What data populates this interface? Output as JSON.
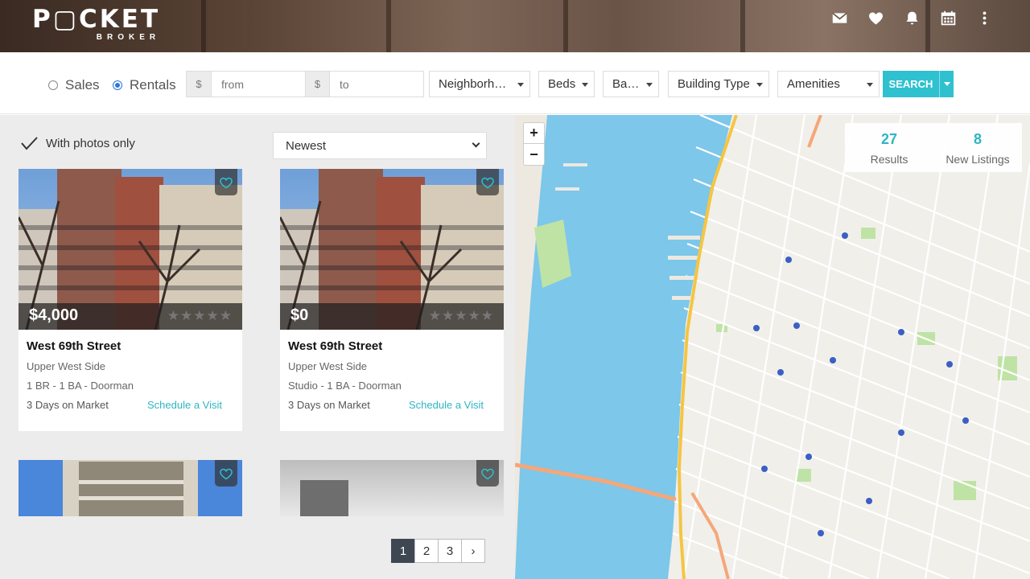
{
  "brand": {
    "name": "P▢CKET",
    "sub": "BROKER"
  },
  "header_icons": [
    "mail-icon",
    "heart-icon",
    "bell-icon",
    "calendar-icon",
    "more-vertical-icon"
  ],
  "filters": {
    "sales_label": "Sales",
    "rentals_label": "Rentals",
    "selected_mode": "Rentals",
    "currency": "$",
    "from_placeholder": "from",
    "to_placeholder": "to",
    "neighborhood": "Neighborhoo…",
    "beds": "Beds",
    "baths": "Baths",
    "building_type": "Building Type",
    "amenities": "Amenities",
    "search_label": "SEARCH"
  },
  "listing_controls": {
    "photos_only_label": "With photos only",
    "sort_value": "Newest"
  },
  "listings": [
    {
      "price": "$4,000",
      "title": "West 69th Street",
      "neighborhood": "Upper West Side",
      "details": "1 BR - 1 BA - Doorman",
      "days": "3 Days on Market",
      "action": "Schedule a Visit"
    },
    {
      "price": "$0",
      "title": "West 69th Street",
      "neighborhood": "Upper West Side",
      "details": "Studio - 1 BA - Doorman",
      "days": "3 Days on Market",
      "action": "Schedule a Visit"
    }
  ],
  "pagination": {
    "pages": [
      "1",
      "2",
      "3"
    ],
    "current": "1",
    "next": "›"
  },
  "map": {
    "zoom_in": "+",
    "zoom_out": "−",
    "results_count": "27",
    "results_label": "Results",
    "new_count": "8",
    "new_label": "New Listings",
    "colors": {
      "water": "#7cc7ea",
      "land": "#f1efea",
      "park": "#bfe3a5",
      "highway": "#f5c542",
      "accent": "#2fb5c4"
    }
  }
}
